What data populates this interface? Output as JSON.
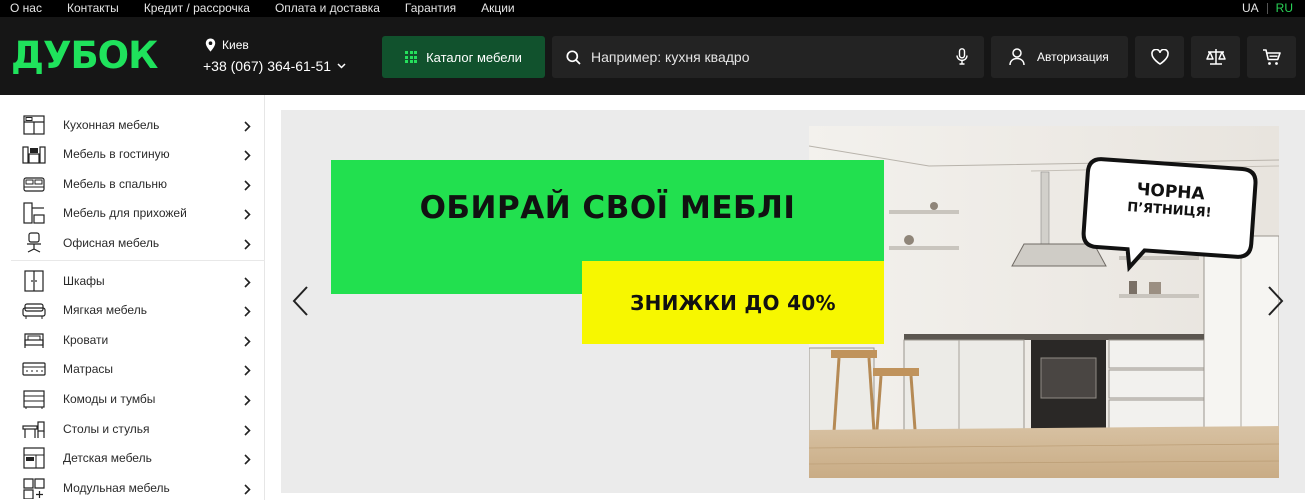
{
  "topbar": {
    "links": [
      "О нас",
      "Контакты",
      "Кредит / рассрочка",
      "Оплата и доставка",
      "Гарантия",
      "Акции"
    ],
    "lang_ua": "UA",
    "lang_ru": "RU"
  },
  "header": {
    "logo": "ДУБОК",
    "city": "Киев",
    "phone": "+38 (067) 364-61-51",
    "catalog_label": "Каталог мебели",
    "search_placeholder": "Например: кухня квадро",
    "auth_label": "Авторизация"
  },
  "sidebar": {
    "items": [
      {
        "label": "Кухонная мебель",
        "icon": "kitchen-icon"
      },
      {
        "label": "Мебель в гостиную",
        "icon": "living-room-icon"
      },
      {
        "label": "Мебель в спальню",
        "icon": "bedroom-icon"
      },
      {
        "label": "Мебель для прихожей",
        "icon": "hallway-icon"
      },
      {
        "label": "Офисная мебель",
        "icon": "office-chair-icon"
      },
      {
        "label": "Шкафы",
        "icon": "wardrobe-icon"
      },
      {
        "label": "Мягкая мебель",
        "icon": "sofa-icon"
      },
      {
        "label": "Кровати",
        "icon": "bed-icon"
      },
      {
        "label": "Матрасы",
        "icon": "mattress-icon"
      },
      {
        "label": "Комоды и тумбы",
        "icon": "dresser-icon"
      },
      {
        "label": "Столы и стулья",
        "icon": "table-chair-icon"
      },
      {
        "label": "Детская мебель",
        "icon": "kids-furniture-icon"
      },
      {
        "label": "Модульная мебель",
        "icon": "modular-icon"
      }
    ]
  },
  "banner": {
    "headline": "ОБИРАЙ СВОЇ МЕБЛІ",
    "discount": "ЗНИЖКИ ДО 40%",
    "bubble_line1": "ЧОРНА",
    "bubble_line2": "П’ЯТНИЦЯ!"
  },
  "colors": {
    "brand_green": "#1fe25c",
    "catalog_button": "#11522d",
    "header_bg": "#161616",
    "banner_green": "#22e04f",
    "banner_yellow": "#f7f700"
  }
}
